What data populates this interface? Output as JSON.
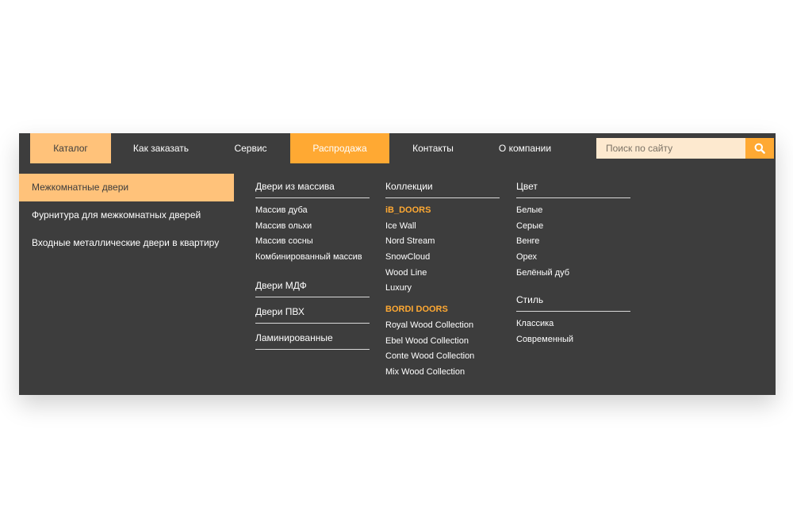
{
  "nav": {
    "items": [
      "Каталог",
      "Как заказать",
      "Сервис",
      "Распродажа",
      "Контакты",
      "О компании"
    ]
  },
  "search": {
    "placeholder": "Поиск по сайту",
    "icon": "search-icon"
  },
  "sidebar": {
    "items": [
      "Межкомнатные двери",
      "Фурнитура для межкомнатных дверей",
      "Входные металлические двери в квартиру"
    ]
  },
  "col1": {
    "groups": [
      {
        "heading": "Двери из массива",
        "links": [
          "Массив дуба",
          "Массив ольхи",
          "Массив сосны",
          "Комбинированный массив"
        ]
      },
      {
        "heading": "Двери МДФ"
      },
      {
        "heading": "Двери ПВХ"
      },
      {
        "heading": "Ламинированные"
      }
    ]
  },
  "col2": {
    "heading": "Коллекции",
    "brands": [
      {
        "name": "iB_DOORS",
        "links": [
          "Ice Wall",
          "Nord Stream",
          "SnowCloud",
          "Wood Line",
          "Luxury"
        ]
      },
      {
        "name": "BORDI DOORS",
        "links": [
          "Royal Wood Collection",
          "Ebel Wood Collection",
          "Conte Wood Collection",
          "Mix Wood Collection"
        ]
      }
    ]
  },
  "col3": {
    "groups": [
      {
        "heading": "Цвет",
        "links": [
          "Белые",
          "Серые",
          "Венге",
          "Орех",
          "Белёный дуб"
        ]
      },
      {
        "heading": "Стиль",
        "links": [
          "Классика",
          "Современный"
        ]
      }
    ]
  },
  "colors": {
    "panel": "#3d3d3d",
    "accent": "#ffa933",
    "accent_light": "#ffc27a",
    "search_bg": "#fde9cf"
  }
}
